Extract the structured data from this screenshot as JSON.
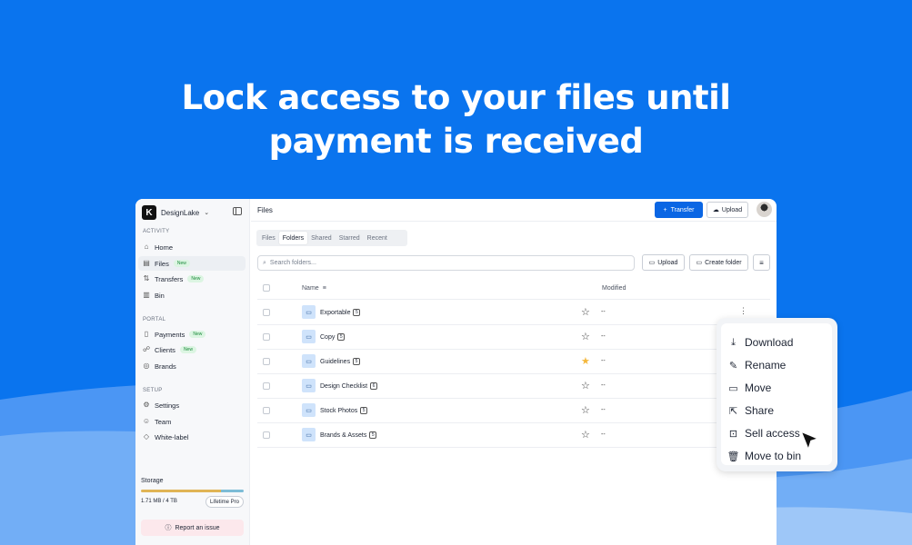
{
  "headline": {
    "line1": "Lock access to your files until",
    "line2": "payment is received"
  },
  "workspace": {
    "logo_letter": "K",
    "name": "DesignLake"
  },
  "sidebar": {
    "sections": [
      {
        "label": "ACTIVITY"
      },
      {
        "label": "PORTAL"
      },
      {
        "label": "SETUP"
      }
    ],
    "items": [
      {
        "label": "Home"
      },
      {
        "label": "Files",
        "badge": "New"
      },
      {
        "label": "Transfers",
        "badge": "New"
      },
      {
        "label": "Bin"
      },
      {
        "label": "Payments",
        "badge": "New"
      },
      {
        "label": "Clients",
        "badge": "New"
      },
      {
        "label": "Brands"
      },
      {
        "label": "Settings"
      },
      {
        "label": "Team"
      },
      {
        "label": "White-label"
      }
    ],
    "storage": {
      "label": "Storage",
      "used": "1.71 MB / 4 TB",
      "plan": "Lifetime Pro"
    },
    "report_label": "Report an issue"
  },
  "topbar": {
    "title": "Files",
    "transfer_label": "Transfer",
    "upload_label": "Upload"
  },
  "tabs": [
    "Files",
    "Folders",
    "Shared",
    "Starred",
    "Recent"
  ],
  "active_tab": "Folders",
  "search": {
    "placeholder": "Search folders..."
  },
  "actions": {
    "upload_label": "Upload",
    "create_label": "Create folder"
  },
  "table": {
    "columns": {
      "name": "Name",
      "modified": "Modified"
    },
    "rows": [
      {
        "name": "Exportable",
        "count": "5",
        "starred": false,
        "modified": "--"
      },
      {
        "name": "Copy",
        "count": "5",
        "starred": false,
        "modified": "--"
      },
      {
        "name": "Guidelines",
        "count": "5",
        "starred": true,
        "modified": "--"
      },
      {
        "name": "Design Checklist",
        "count": "6",
        "starred": false,
        "modified": "--"
      },
      {
        "name": "Stock Photos",
        "count": "5",
        "starred": false,
        "modified": "--"
      },
      {
        "name": "Brands & Assets",
        "count": "5",
        "starred": false,
        "modified": "--"
      }
    ]
  },
  "context_menu": {
    "items": [
      "Download",
      "Rename",
      "Move",
      "Share",
      "Sell access",
      "Move to bin"
    ]
  },
  "colors": {
    "background": "#0a74ee",
    "primary_button": "#0a66e4",
    "star": "#f4b73b"
  }
}
